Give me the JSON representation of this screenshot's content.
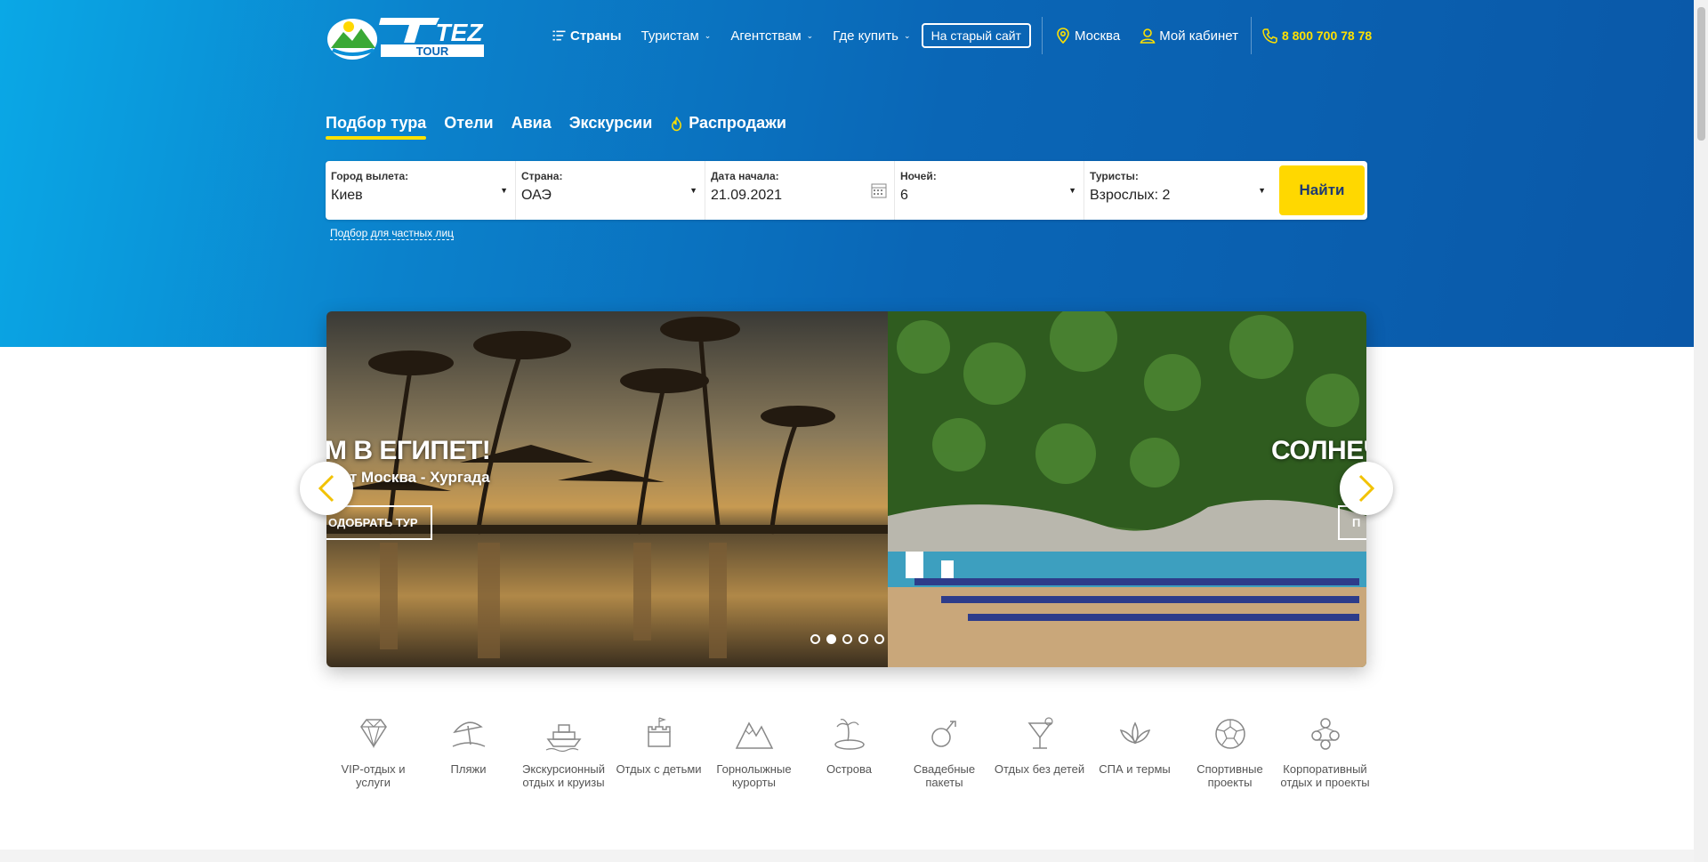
{
  "header": {
    "logo_text_top": "TEZ",
    "logo_text_bottom": "TOUR",
    "nav": [
      {
        "label": "Страны"
      },
      {
        "label": "Туристам"
      },
      {
        "label": "Агентствам"
      },
      {
        "label": "Где купить"
      }
    ],
    "old_site": "На старый сайт",
    "city": "Москва",
    "cabinet": "Мой кабинет",
    "phone": "8 800 700 78 78"
  },
  "tabs": [
    {
      "label": "Подбор тура"
    },
    {
      "label": "Отели"
    },
    {
      "label": "Авиа"
    },
    {
      "label": "Экскурсии"
    },
    {
      "label": "Распродажи"
    }
  ],
  "search": {
    "fields": [
      {
        "label": "Город вылета:",
        "value": "Киев"
      },
      {
        "label": "Страна:",
        "value": "ОАЭ"
      },
      {
        "label": "Дата начала:",
        "value": "21.09.2021"
      },
      {
        "label": "Ночей:",
        "value": "6"
      },
      {
        "label": "Туристы:",
        "value": "Взрослых: 2"
      }
    ],
    "find_label": "Найти",
    "private_link": "Подбор для частных лиц"
  },
  "slider": {
    "slides": [
      {
        "title": "М В ЕГИПЕТ!",
        "subtitle": "т Москва - Хургада",
        "button": "ОДОБРАТЬ ТУР"
      },
      {
        "title": "СОЛНЕЧ",
        "button": "П"
      }
    ],
    "dot_count": 5,
    "active_dot": 2
  },
  "categories": [
    {
      "label": "VIP-отдых и услуги",
      "icon": "diamond-icon"
    },
    {
      "label": "Пляжи",
      "icon": "beach-umbrella-icon"
    },
    {
      "label": "Экскурсионный отдых и круизы",
      "icon": "ship-icon"
    },
    {
      "label": "Отдых с детьми",
      "icon": "sandcastle-icon"
    },
    {
      "label": "Горнолыжные курорты",
      "icon": "mountains-icon"
    },
    {
      "label": "Острова",
      "icon": "island-icon"
    },
    {
      "label": "Свадебные пакеты",
      "icon": "wedding-icon"
    },
    {
      "label": "Отдых без детей",
      "icon": "cocktail-icon"
    },
    {
      "label": "СПА и термы",
      "icon": "lotus-icon"
    },
    {
      "label": "Спортивные проекты",
      "icon": "soccer-ball-icon"
    },
    {
      "label": "Корпоративный отдых и проекты",
      "icon": "group-icon"
    }
  ],
  "colors": {
    "accent_yellow": "#ffd800",
    "hero_blue": "#0a66b6",
    "button_text": "#1f3a72"
  }
}
